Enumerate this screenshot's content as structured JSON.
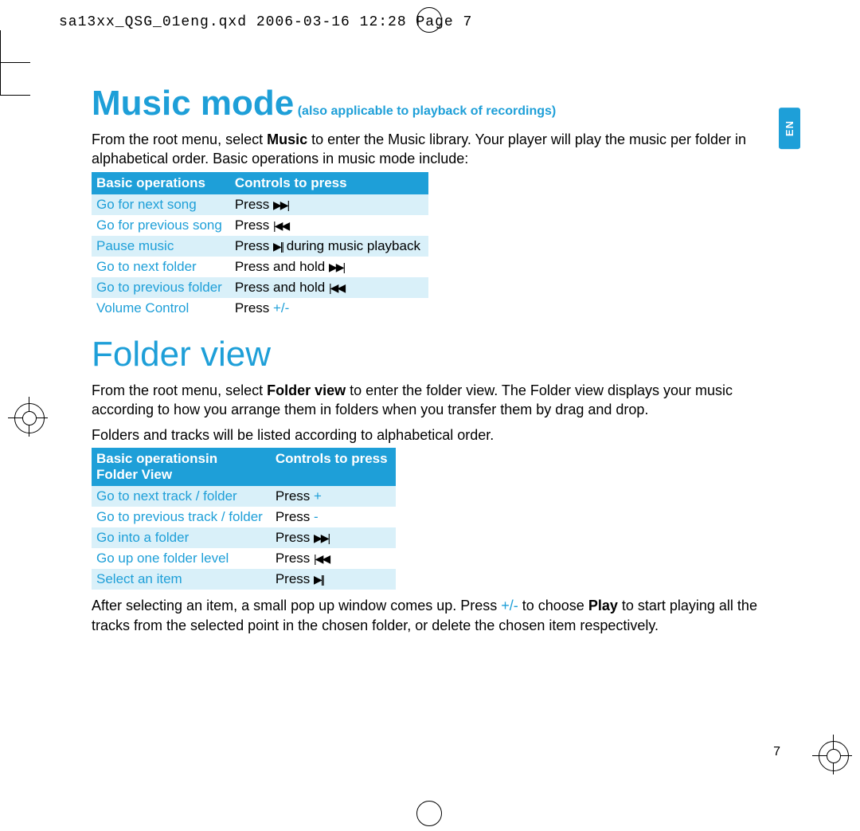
{
  "print_header": "sa13xx_QSG_01eng.qxd  2006-03-16  12:28  Page 7",
  "lang_tab": "EN",
  "music": {
    "title": "Music mode",
    "subtitle": " (also applicable to playback of recordings)",
    "intro_before": "From the root menu, select ",
    "intro_bold": "Music",
    "intro_after": " to enter the Music library. Your player will play the music per folder in alphabetical order. Basic operations in music mode include:",
    "headers": [
      "Basic operations",
      "Controls to press"
    ],
    "rows": [
      {
        "op": "Go for next song",
        "ctrl_pre": "Press ",
        "icon": "▶▶|",
        "ctrl_post": ""
      },
      {
        "op": "Go for previous song",
        "ctrl_pre": "Press ",
        "icon": "|◀◀",
        "ctrl_post": ""
      },
      {
        "op": "Pause music",
        "ctrl_pre": "Press ",
        "icon": "▶||",
        "ctrl_post": " during music playback"
      },
      {
        "op": "Go to next folder",
        "ctrl_pre": "Press and hold ",
        "icon": "▶▶|",
        "ctrl_post": ""
      },
      {
        "op": "Go to previous folder",
        "ctrl_pre": "Press and hold ",
        "icon": "|◀◀",
        "ctrl_post": ""
      },
      {
        "op": "Volume Control",
        "ctrl_pre": "Press ",
        "plus_minus": "+/-",
        "ctrl_post": ""
      }
    ]
  },
  "folder": {
    "title": "Folder view",
    "intro_before": "From the root menu, select ",
    "intro_bold": "Folder view",
    "intro_after": " to enter the folder view. The Folder view displays your music according to how you arrange them in folders when you transfer them by drag and drop.",
    "note": "Folders and tracks will be listed according to alphabetical order.",
    "headers": [
      "Basic operationsin Folder View",
      "Controls to press"
    ],
    "header1_line1": "Basic operationsin",
    "header1_line2": "Folder View",
    "rows": [
      {
        "op": "Go to next track / folder",
        "ctrl_pre": "Press ",
        "plus_minus": "+"
      },
      {
        "op": "Go to previous track / folder",
        "ctrl_pre": "Press ",
        "plus_minus": "-"
      },
      {
        "op": "Go into a folder",
        "ctrl_pre": "Press ",
        "icon": "▶▶|"
      },
      {
        "op": "Go up one folder level",
        "ctrl_pre": "Press ",
        "icon": "|◀◀"
      },
      {
        "op": "Select an item",
        "ctrl_pre": "Press ",
        "icon": "▶||"
      }
    ],
    "outro_1": "After selecting an item, a small pop up window comes up. Press ",
    "outro_pm": "+/-",
    "outro_2": " to choose ",
    "outro_bold": "Play",
    "outro_3": " to start playing all the tracks from the selected point in the chosen folder, or delete the chosen item respectively."
  },
  "page_number": "7"
}
